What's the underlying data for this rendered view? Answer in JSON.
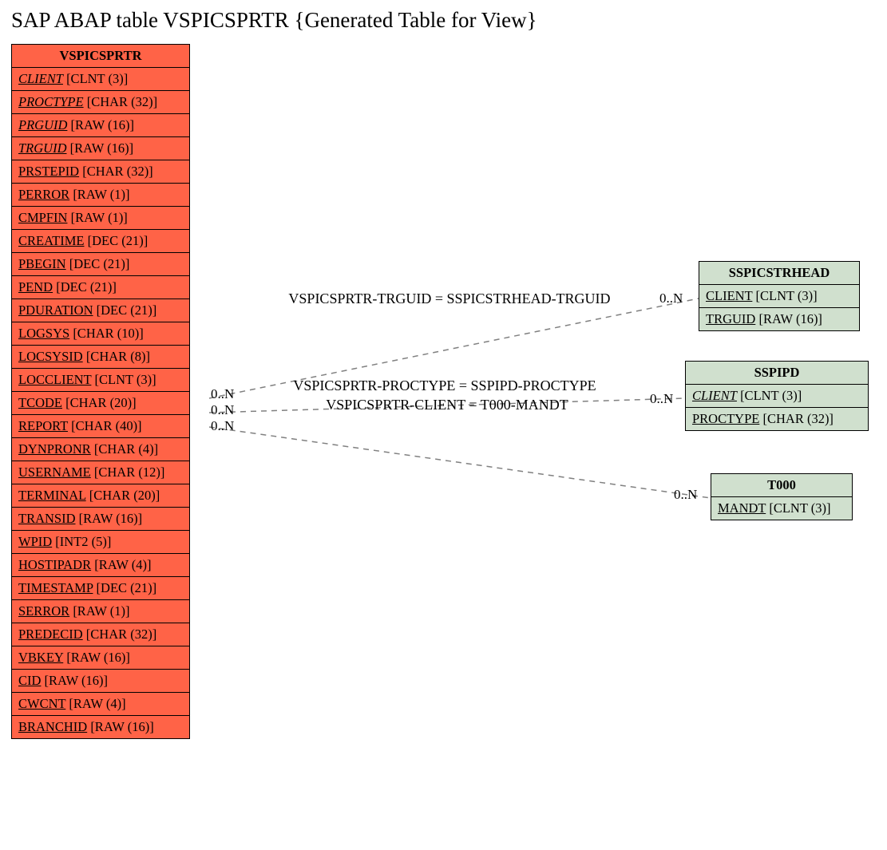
{
  "title": "SAP ABAP table VSPICSPRTR {Generated Table for View}",
  "main_table": {
    "name": "VSPICSPRTR",
    "fields": [
      {
        "name": "CLIENT",
        "type": "[CLNT (3)]",
        "italic": true
      },
      {
        "name": "PROCTYPE",
        "type": "[CHAR (32)]",
        "italic": true
      },
      {
        "name": "PRGUID",
        "type": "[RAW (16)]",
        "italic": true
      },
      {
        "name": "TRGUID",
        "type": "[RAW (16)]",
        "italic": true
      },
      {
        "name": "PRSTEPID",
        "type": "[CHAR (32)]",
        "italic": false
      },
      {
        "name": "PERROR",
        "type": "[RAW (1)]",
        "italic": false
      },
      {
        "name": "CMPFIN",
        "type": "[RAW (1)]",
        "italic": false
      },
      {
        "name": "CREATIME",
        "type": "[DEC (21)]",
        "italic": false
      },
      {
        "name": "PBEGIN",
        "type": "[DEC (21)]",
        "italic": false
      },
      {
        "name": "PEND",
        "type": "[DEC (21)]",
        "italic": false
      },
      {
        "name": "PDURATION",
        "type": "[DEC (21)]",
        "italic": false
      },
      {
        "name": "LOGSYS",
        "type": "[CHAR (10)]",
        "italic": false
      },
      {
        "name": "LOCSYSID",
        "type": "[CHAR (8)]",
        "italic": false
      },
      {
        "name": "LOCCLIENT",
        "type": "[CLNT (3)]",
        "italic": false
      },
      {
        "name": "TCODE",
        "type": "[CHAR (20)]",
        "italic": false
      },
      {
        "name": "REPORT",
        "type": "[CHAR (40)]",
        "italic": false
      },
      {
        "name": "DYNPRONR",
        "type": "[CHAR (4)]",
        "italic": false
      },
      {
        "name": "USERNAME",
        "type": "[CHAR (12)]",
        "italic": false
      },
      {
        "name": "TERMINAL",
        "type": "[CHAR (20)]",
        "italic": false
      },
      {
        "name": "TRANSID",
        "type": "[RAW (16)]",
        "italic": false
      },
      {
        "name": "WPID",
        "type": "[INT2 (5)]",
        "italic": false
      },
      {
        "name": "HOSTIPADR",
        "type": "[RAW (4)]",
        "italic": false
      },
      {
        "name": "TIMESTAMP",
        "type": "[DEC (21)]",
        "italic": false
      },
      {
        "name": "SERROR",
        "type": "[RAW (1)]",
        "italic": false
      },
      {
        "name": "PREDECID",
        "type": "[CHAR (32)]",
        "italic": false
      },
      {
        "name": "VBKEY",
        "type": "[RAW (16)]",
        "italic": false
      },
      {
        "name": "CID",
        "type": "[RAW (16)]",
        "italic": false
      },
      {
        "name": "CWCNT",
        "type": "[RAW (4)]",
        "italic": false
      },
      {
        "name": "BRANCHID",
        "type": "[RAW (16)]",
        "italic": false
      }
    ]
  },
  "rel_tables": [
    {
      "name": "SSPICSTRHEAD",
      "fields": [
        {
          "name": "CLIENT",
          "type": "[CLNT (3)]",
          "italic": false
        },
        {
          "name": "TRGUID",
          "type": "[RAW (16)]",
          "italic": false
        }
      ]
    },
    {
      "name": "SSPIPD",
      "fields": [
        {
          "name": "CLIENT",
          "type": "[CLNT (3)]",
          "italic": true
        },
        {
          "name": "PROCTYPE",
          "type": "[CHAR (32)]",
          "italic": false
        }
      ]
    },
    {
      "name": "T000",
      "fields": [
        {
          "name": "MANDT",
          "type": "[CLNT (3)]",
          "italic": false
        }
      ]
    }
  ],
  "joins": [
    "VSPICSPRTR-TRGUID = SSPICSTRHEAD-TRGUID",
    "VSPICSPRTR-PROCTYPE = SSPIPD-PROCTYPE",
    "VSPICSPRTR-CLIENT = T000-MANDT"
  ],
  "cardinality_left": [
    "0..N",
    "0..N",
    "0..N"
  ],
  "cardinality_right": [
    "0..N",
    "0..N",
    "0..N"
  ]
}
